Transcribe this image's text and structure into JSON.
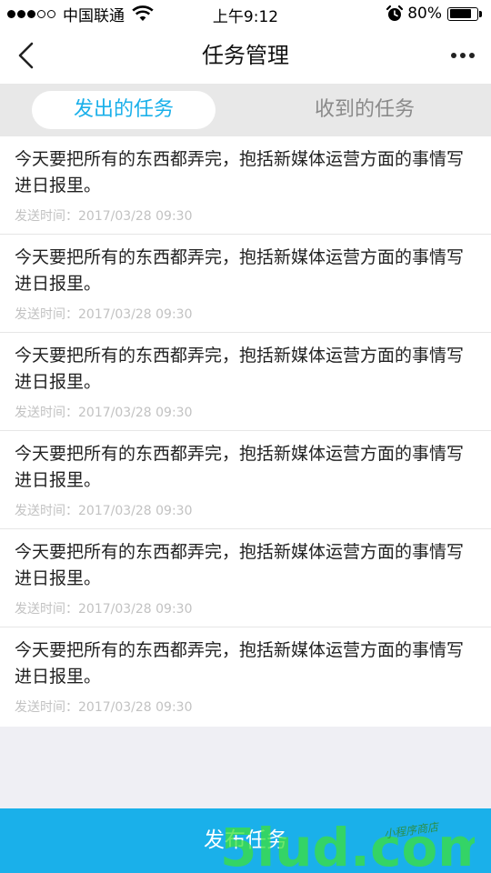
{
  "status_bar": {
    "carrier": "中国联通",
    "time": "上午9:12",
    "battery": "80%",
    "battery_level": 0.8
  },
  "nav": {
    "title": "任务管理",
    "back_icon": "chevron-left-icon",
    "more_icon": "more-dots-icon"
  },
  "tabs": [
    {
      "label": "发出的任务",
      "active": true
    },
    {
      "label": "收到的任务",
      "active": false
    }
  ],
  "tasks": [
    {
      "content": "今天要把所有的东西都弄完，抱括新媒体运营方面的事情写进日报里。",
      "time": "发送时间：2017/03/28 09:30"
    },
    {
      "content": "今天要把所有的东西都弄完，抱括新媒体运营方面的事情写进日报里。",
      "time": "发送时间：2017/03/28 09:30"
    },
    {
      "content": "今天要把所有的东西都弄完，抱括新媒体运营方面的事情写进日报里。",
      "time": "发送时间：2017/03/28 09:30"
    },
    {
      "content": "今天要把所有的东西都弄完，抱括新媒体运营方面的事情写进日报里。",
      "time": "发送时间：2017/03/28 09:30"
    },
    {
      "content": "今天要把所有的东西都弄完，抱括新媒体运营方面的事情写进日报里。",
      "time": "发送时间：2017/03/28 09:30"
    },
    {
      "content": "今天要把所有的东西都弄完，抱括新媒体运营方面的事情写进日报里。",
      "time": "发送时间：2017/03/28 09:30"
    }
  ],
  "publish_button": "发布任务",
  "watermark": {
    "main": "5lud.com",
    "tag": "小程序商店"
  },
  "colors": {
    "accent": "#1ab0ea",
    "watermark": "#3de03a"
  }
}
